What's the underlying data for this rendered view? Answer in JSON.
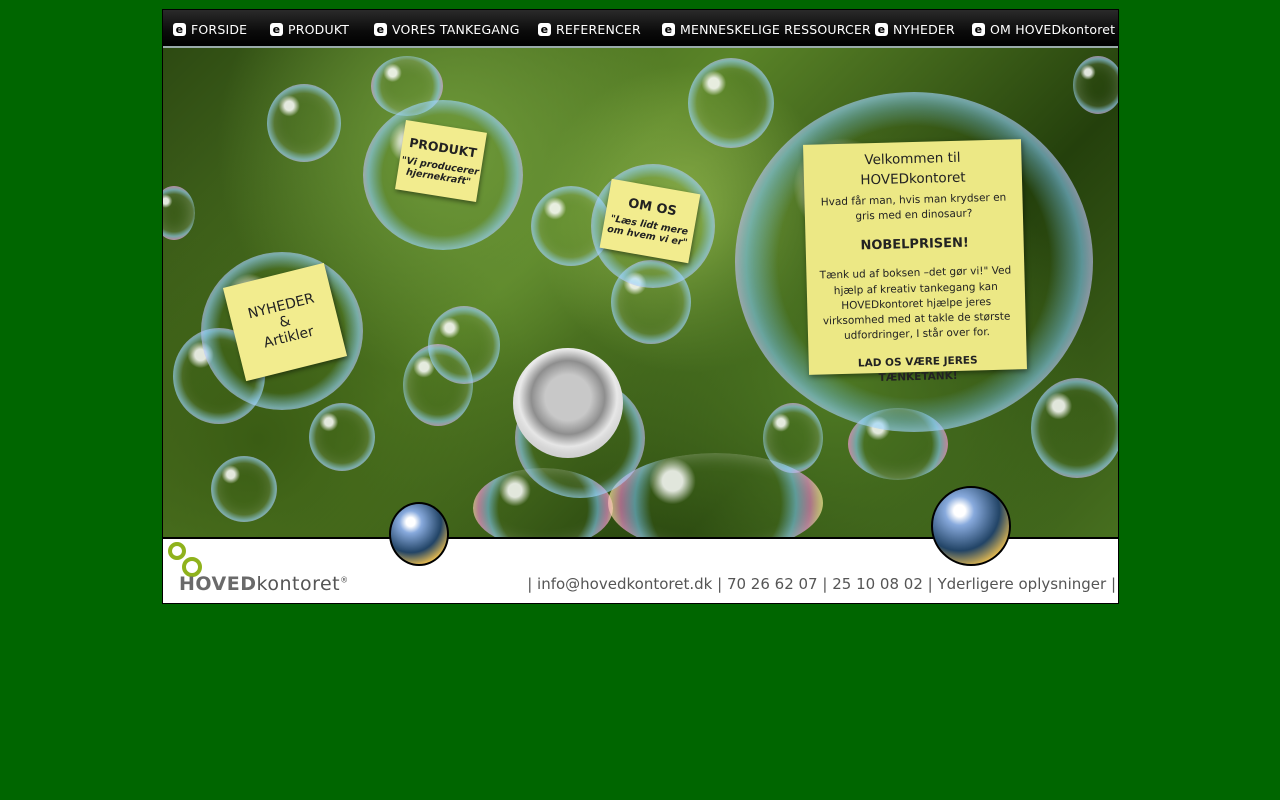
{
  "nav": {
    "items": [
      {
        "icon": "e",
        "label": "FORSIDE"
      },
      {
        "icon": "e",
        "label": "PRODUKT"
      },
      {
        "icon": "e",
        "label": "VORES TANKEGANG"
      },
      {
        "icon": "e",
        "label": "REFERENCER"
      },
      {
        "icon": "e",
        "label": "MENNESKELIGE RESSOURCER"
      },
      {
        "icon": "e",
        "label": "NYHEDER"
      },
      {
        "icon": "e",
        "label": "OM HOVEDkontoret"
      }
    ]
  },
  "hero": {
    "produkt_note": {
      "title": "PRODUKT",
      "subtitle": "\"Vi producerer hjernekraft\""
    },
    "omos_note": {
      "title": "OM OS",
      "subtitle": "\"Læs lidt mere om hvem vi er\""
    },
    "nyheder_note": {
      "line1": "NYHEDER",
      "line2": "&",
      "line3": "Artikler"
    },
    "welcome": {
      "title": "Velkommen til HOVEDkontoret",
      "question": "Hvad får man, hvis man krydser en gris med en dinosaur?",
      "answer": "NOBELPRISEN!",
      "body": "Tænk ud af boksen –det gør vi!\" Ved hjælp af kreativ tankegang kan HOVEDkontoret hjælpe jeres virksomhed med at takle de største udfordringer, I står over for.",
      "cta": "LAD OS VÆRE JERES TÆNKETANK!"
    }
  },
  "footer": {
    "logo_bold": "HOVED",
    "logo_rest": "kontoret",
    "logo_mark": "®",
    "sep": "|",
    "email": "info@hovedkontoret.dk",
    "phone1": "70 26 62 07",
    "phone2": "25 10 08 02",
    "more": "Yderligere oplysninger"
  },
  "colors": {
    "page_bg": "#006600",
    "note_yellow": "#f2ec8e",
    "logo_green": "#8fb21c"
  }
}
